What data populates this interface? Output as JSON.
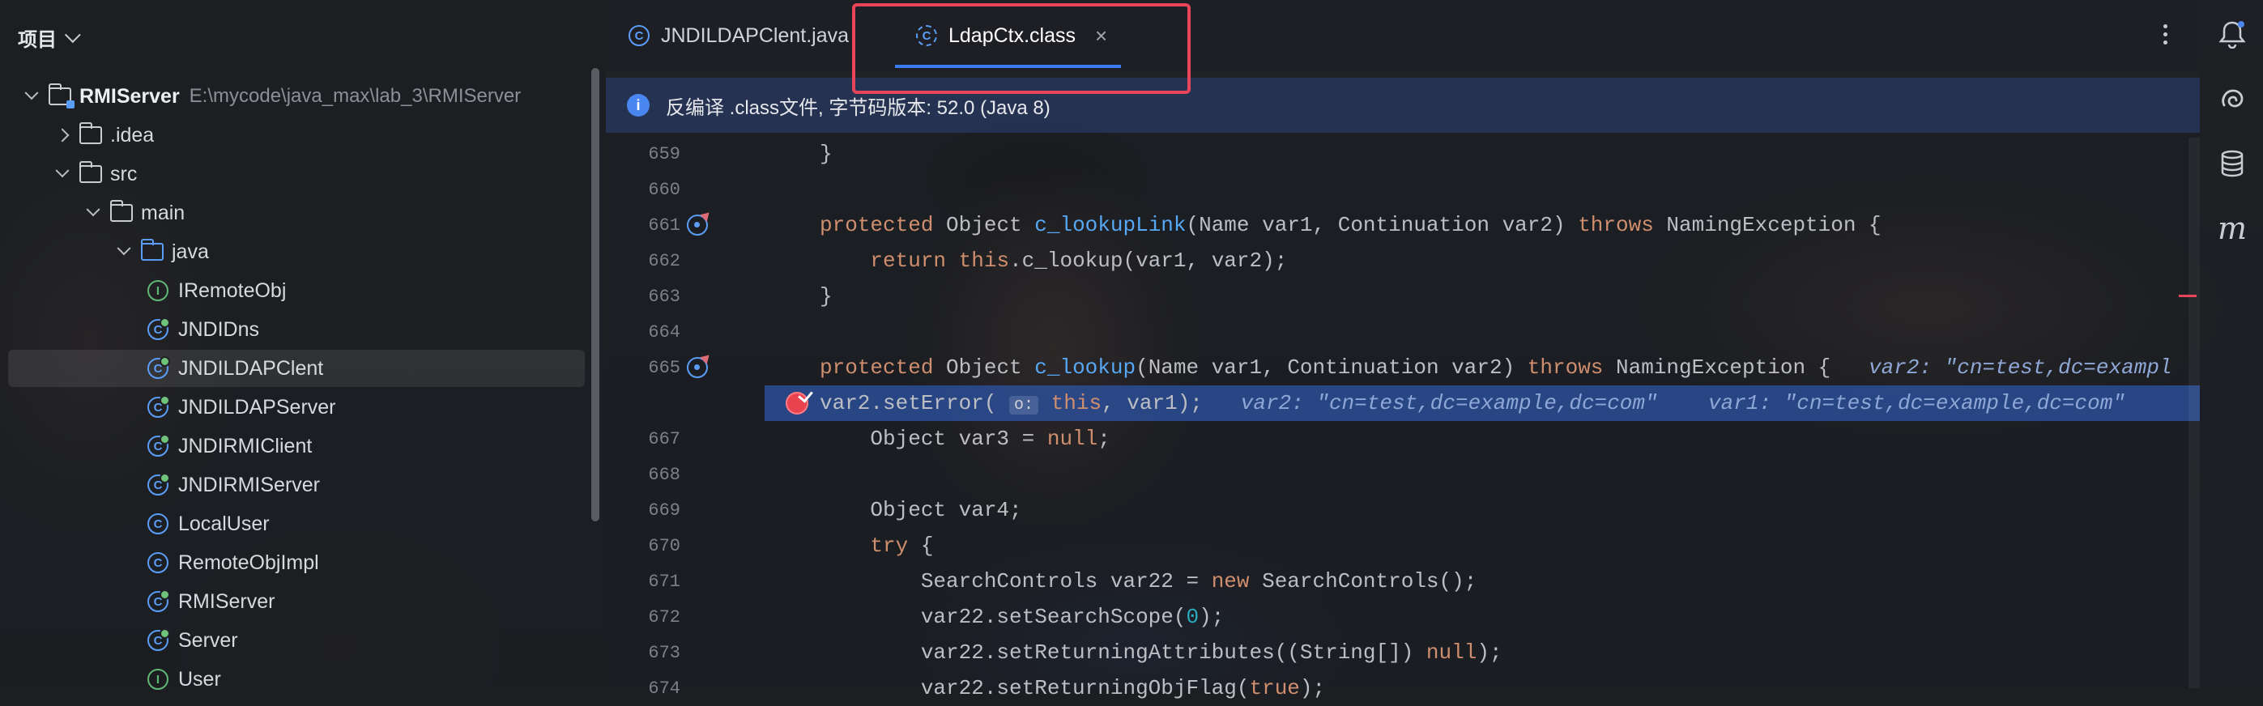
{
  "project_panel": {
    "title": "项目",
    "tree": [
      {
        "name": "RMIServer",
        "path": "E:\\mycode\\java_max\\lab_3\\RMIServer",
        "kind": "module",
        "expanded": true,
        "depth": 0,
        "bold": true
      },
      {
        "name": ".idea",
        "kind": "folder",
        "expanded": false,
        "depth": 1
      },
      {
        "name": "src",
        "kind": "folder",
        "expanded": true,
        "depth": 1
      },
      {
        "name": "main",
        "kind": "folder",
        "expanded": true,
        "depth": 2
      },
      {
        "name": "java",
        "kind": "source-folder",
        "expanded": true,
        "depth": 3
      },
      {
        "name": "IRemoteObj",
        "kind": "interface",
        "depth": 4
      },
      {
        "name": "JNDIDns",
        "kind": "runnable-class",
        "depth": 4
      },
      {
        "name": "JNDILDAPClent",
        "kind": "runnable-class",
        "depth": 4,
        "selected": true
      },
      {
        "name": "JNDILDAPServer",
        "kind": "runnable-class",
        "depth": 4
      },
      {
        "name": "JNDIRMIClient",
        "kind": "runnable-class",
        "depth": 4
      },
      {
        "name": "JNDIRMIServer",
        "kind": "runnable-class",
        "depth": 4
      },
      {
        "name": "LocalUser",
        "kind": "class",
        "depth": 4
      },
      {
        "name": "RemoteObjImpl",
        "kind": "class",
        "depth": 4
      },
      {
        "name": "RMIServer",
        "kind": "runnable-class",
        "depth": 4
      },
      {
        "name": "Server",
        "kind": "runnable-class",
        "depth": 4
      },
      {
        "name": "User",
        "kind": "interface",
        "depth": 4
      }
    ]
  },
  "tabs": [
    {
      "label": "JNDILDAPClent.java",
      "icon": "class-icon",
      "active": false
    },
    {
      "label": "LdapCtx.class",
      "icon": "decompiled-class-icon",
      "active": true,
      "close": "×"
    }
  ],
  "info_banner": {
    "text": "反编译 .class文件, 字节码版本: 52.0 (Java 8)"
  },
  "code": {
    "lines": [
      {
        "num": "659",
        "html": "}"
      },
      {
        "num": "660",
        "html": ""
      },
      {
        "num": "661",
        "gutter": "override",
        "html": "<span class=\"kw\">protected</span> Object <span class=\"fn\">c_lookupLink</span>(Name var1, Continuation var2) <span class=\"kw\">throws</span> NamingException {"
      },
      {
        "num": "662",
        "html": "    <span class=\"kw\">return this</span>.c_lookup(var1, var2);"
      },
      {
        "num": "663",
        "html": "}"
      },
      {
        "num": "664",
        "html": ""
      },
      {
        "num": "665",
        "gutter": "override",
        "html": "<span class=\"kw\">protected</span> Object <span class=\"fn\">c_lookup</span>(Name var1, Continuation var2) <span class=\"kw\">throws</span> NamingException {   <span class=\"hint\">var2: \"cn=test,dc=exampl</span>"
      },
      {
        "num": "",
        "gutter": "breakpoint",
        "exec": true,
        "html": "var2.setError( <span class=\"inlay\">o:</span> <span class=\"kw\">this</span>, var1);   <span class=\"hint\">var2: \"cn=test,dc=example,dc=com\"    var1: \"cn=test,dc=example,dc=com\"</span>"
      },
      {
        "num": "667",
        "html": "    Object var3 = <span class=\"kw\">null</span>;"
      },
      {
        "num": "668",
        "html": ""
      },
      {
        "num": "669",
        "html": "    Object var4;"
      },
      {
        "num": "670",
        "html": "    <span class=\"kw\">try</span> {"
      },
      {
        "num": "671",
        "html": "        SearchControls var22 = <span class=\"kw\">new</span> SearchControls();"
      },
      {
        "num": "672",
        "html": "        var22.setSearchScope(<span class=\"num\">0</span>);"
      },
      {
        "num": "673",
        "html": "        var22.setReturningAttributes((String[]) <span class=\"kw\">null</span>);"
      },
      {
        "num": "674",
        "html": "        var22.setReturningObjFlag(<span class=\"kw\">true</span>);"
      }
    ]
  },
  "tool_strip": [
    "notifications-icon",
    "ai-assistant-icon",
    "database-icon",
    "maven-icon"
  ],
  "colors": {
    "accent": "#3b7bf0",
    "highlight": "#e8445a",
    "keyword": "#cf8e6d",
    "function": "#56a8f5"
  }
}
